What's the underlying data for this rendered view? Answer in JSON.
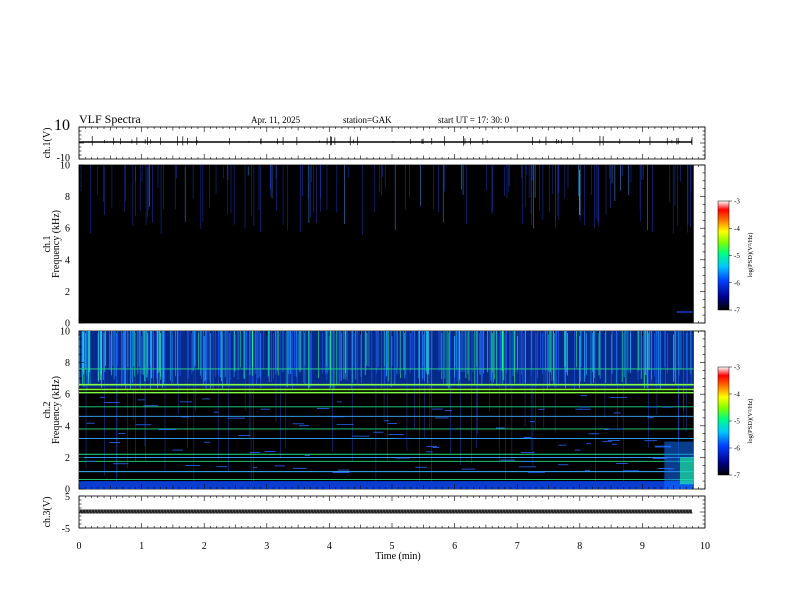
{
  "header": {
    "title": "VLF  Spectra",
    "date": "Apr. 11,  2025",
    "station": "station=GAK",
    "start": "start  UT  =    17: 30: 0"
  },
  "chart_data": {
    "type": "heatmap",
    "x_axis": {
      "label": "Time  (min)",
      "range": [
        0,
        10
      ],
      "ticks": [
        "0",
        "1",
        "2",
        "3",
        "4",
        "5",
        "6",
        "7",
        "8",
        "9",
        "10"
      ]
    },
    "panels": [
      {
        "name": "ch.1 waveform",
        "ylabel": "ch.1(V)",
        "ylim": [
          -10,
          10
        ],
        "yticks": [
          "10",
          "-10"
        ],
        "baseline": 0
      },
      {
        "name": "ch.1 spectrogram",
        "ylabel": "ch.1",
        "ylabel2": "Frequency  (kHz)",
        "ylim": [
          0,
          10
        ],
        "yticks": [
          "0",
          "2",
          "4",
          "6",
          "8",
          "10"
        ],
        "data_end_min": 9.82,
        "colorbar": {
          "range": [
            -7,
            -3
          ],
          "ticks": [
            "-3",
            "-4",
            "-5",
            "-6",
            "-7"
          ],
          "label": "log(PSD)(V²/Hz)"
        }
      },
      {
        "name": "ch.2 spectrogram",
        "ylabel": "ch.2",
        "ylabel2": "Frequency  (kHz)",
        "ylim": [
          0,
          10
        ],
        "yticks": [
          "0",
          "2",
          "4",
          "6",
          "8",
          "10"
        ],
        "data_end_min": 9.82,
        "line_features_khz": [
          0.3,
          0.6,
          1.1,
          1.75,
          2.0,
          2.2,
          3.2,
          3.8,
          4.6,
          5.2,
          6.1,
          6.3,
          6.6,
          7.6
        ],
        "colorbar": {
          "range": [
            -7,
            -3
          ],
          "ticks": [
            "-3",
            "-4",
            "-5",
            "-6",
            "-7"
          ],
          "label": "log(PSD)(V²/Hz)"
        }
      },
      {
        "name": "ch.3 waveform",
        "ylabel": "ch.3(V)",
        "ylim": [
          -5,
          5
        ],
        "yticks": [
          "5",
          "-5"
        ],
        "baseline": -1.1
      }
    ]
  },
  "colors": {
    "background": "#000000",
    "frame": "#000000"
  }
}
